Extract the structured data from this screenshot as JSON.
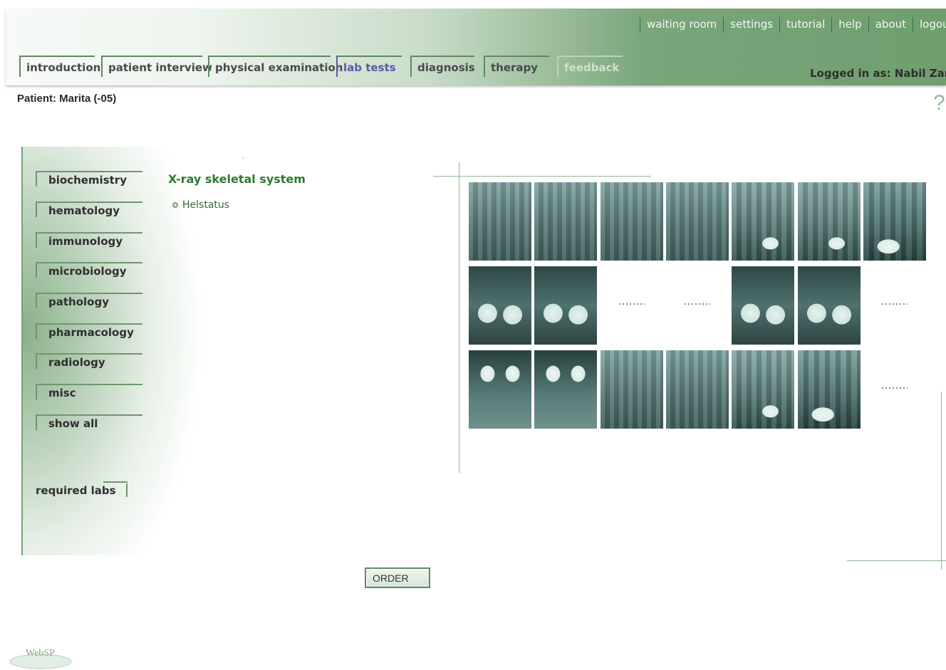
{
  "top_nav": [
    "waiting room",
    "settings",
    "tutorial",
    "help",
    "about",
    "logout"
  ],
  "tabs": [
    {
      "label": "introduction"
    },
    {
      "label": "patient interview"
    },
    {
      "label": "physical examination"
    },
    {
      "label": "lab tests",
      "state": "active"
    },
    {
      "label": "diagnosis"
    },
    {
      "label": "therapy"
    },
    {
      "label": "feedback",
      "state": "faded"
    }
  ],
  "logged_in": "Logged in as: Nabil Zary",
  "patient": "Patient: Marita (-05)",
  "help_symbol": "?",
  "lab_categories": [
    "biochemistry",
    "hematology",
    "immunology",
    "microbiology",
    "pathology",
    "pharmacology",
    "radiology",
    "misc",
    "show all"
  ],
  "required_labs": "required labs",
  "section_title": "X-ray skeletal system",
  "results": [
    "Helstatus"
  ],
  "xray_rows": [
    [
      "upper",
      "upper",
      "upper",
      "upper",
      "fill1",
      "fill1",
      "fill2"
    ],
    [
      "dark",
      "dark",
      "missing",
      "missing",
      "dark",
      "dark",
      "missing"
    ],
    [
      "crown",
      "crown",
      "upper",
      "upper",
      "fill1",
      "fill2",
      "missing"
    ]
  ],
  "order_label": "ORDER",
  "logo_text": "WebSP",
  "colors": {
    "header_green": "#6f9e6f",
    "active_tab": "#5a5aa8",
    "title_green": "#2f7a2f"
  }
}
